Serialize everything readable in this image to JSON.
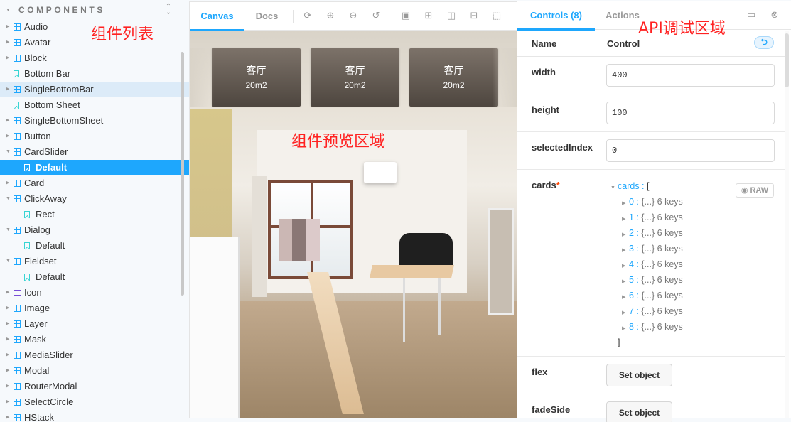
{
  "sidebar": {
    "title": "COMPONENTS",
    "items": [
      {
        "label": "Audio",
        "type": "component",
        "expanded": false
      },
      {
        "label": "Avatar",
        "type": "component",
        "expanded": false
      },
      {
        "label": "Block",
        "type": "component",
        "expanded": false
      },
      {
        "label": "Bottom Bar",
        "type": "story"
      },
      {
        "label": "SingleBottomBar",
        "type": "component",
        "expanded": false,
        "highlighted": true
      },
      {
        "label": "Bottom Sheet",
        "type": "story"
      },
      {
        "label": "SingleBottomSheet",
        "type": "component",
        "expanded": false
      },
      {
        "label": "Button",
        "type": "component",
        "expanded": false
      },
      {
        "label": "CardSlider",
        "type": "component",
        "expanded": true
      },
      {
        "label": "Default",
        "type": "story",
        "selected": true,
        "child": true
      },
      {
        "label": "Card",
        "type": "component",
        "expanded": false
      },
      {
        "label": "ClickAway",
        "type": "component",
        "expanded": true
      },
      {
        "label": "Rect",
        "type": "story",
        "child": true
      },
      {
        "label": "Dialog",
        "type": "component",
        "expanded": true
      },
      {
        "label": "Default",
        "type": "story",
        "child": true
      },
      {
        "label": "Fieldset",
        "type": "component",
        "expanded": true
      },
      {
        "label": "Default",
        "type": "story",
        "child": true
      },
      {
        "label": "Icon",
        "type": "folder",
        "expanded": false
      },
      {
        "label": "Image",
        "type": "component",
        "expanded": false
      },
      {
        "label": "Layer",
        "type": "component",
        "expanded": false
      },
      {
        "label": "Mask",
        "type": "component",
        "expanded": false
      },
      {
        "label": "MediaSlider",
        "type": "component",
        "expanded": false
      },
      {
        "label": "Modal",
        "type": "component",
        "expanded": false
      },
      {
        "label": "RouterModal",
        "type": "component",
        "expanded": false
      },
      {
        "label": "SelectCircle",
        "type": "component",
        "expanded": false
      },
      {
        "label": "HStack",
        "type": "component",
        "expanded": false
      }
    ]
  },
  "annotations": {
    "sidebar": "组件列表",
    "preview": "组件预览区域",
    "controls": "API调试区域"
  },
  "preview": {
    "tabs": [
      {
        "label": "Canvas",
        "active": true
      },
      {
        "label": "Docs",
        "active": false
      }
    ],
    "toolbar_icons": [
      "refresh-icon",
      "zoom-in-icon",
      "zoom-out-icon",
      "zoom-reset-icon",
      "background-icon",
      "grid-icon",
      "viewport-icon",
      "measure-icon",
      "outline-icon"
    ],
    "cards": [
      {
        "title": "客厅",
        "area": "20m2"
      },
      {
        "title": "客厅",
        "area": "20m2"
      },
      {
        "title": "客厅",
        "area": "20m2"
      }
    ]
  },
  "controls": {
    "tabs": [
      {
        "label": "Controls (8)",
        "active": true
      },
      {
        "label": "Actions",
        "active": false
      }
    ],
    "header": {
      "name": "Name",
      "control": "Control"
    },
    "reset_icon": "undo-icon",
    "rows": {
      "width": {
        "label": "width",
        "value": "400"
      },
      "height": {
        "label": "height",
        "value": "100"
      },
      "selectedIndex": {
        "label": "selectedIndex",
        "value": "0"
      },
      "cards": {
        "label": "cards",
        "required_mark": "*",
        "root_key": "cards",
        "open_bracket": "[",
        "close_bracket": "]",
        "raw_label": "RAW",
        "entries": [
          {
            "index": "0",
            "summary": "{...}",
            "keys": "6 keys"
          },
          {
            "index": "1",
            "summary": "{...}",
            "keys": "6 keys"
          },
          {
            "index": "2",
            "summary": "{...}",
            "keys": "6 keys"
          },
          {
            "index": "3",
            "summary": "{...}",
            "keys": "6 keys"
          },
          {
            "index": "4",
            "summary": "{...}",
            "keys": "6 keys"
          },
          {
            "index": "5",
            "summary": "{...}",
            "keys": "6 keys"
          },
          {
            "index": "6",
            "summary": "{...}",
            "keys": "6 keys"
          },
          {
            "index": "7",
            "summary": "{...}",
            "keys": "6 keys"
          },
          {
            "index": "8",
            "summary": "{...}",
            "keys": "6 keys"
          }
        ]
      },
      "flex": {
        "label": "flex",
        "button": "Set object"
      },
      "fadeSide": {
        "label": "fadeSide",
        "button": "Set object"
      }
    }
  },
  "colors": {
    "accent": "#1ea7fd",
    "annotation": "#ff2222",
    "required": "#ff4400"
  }
}
